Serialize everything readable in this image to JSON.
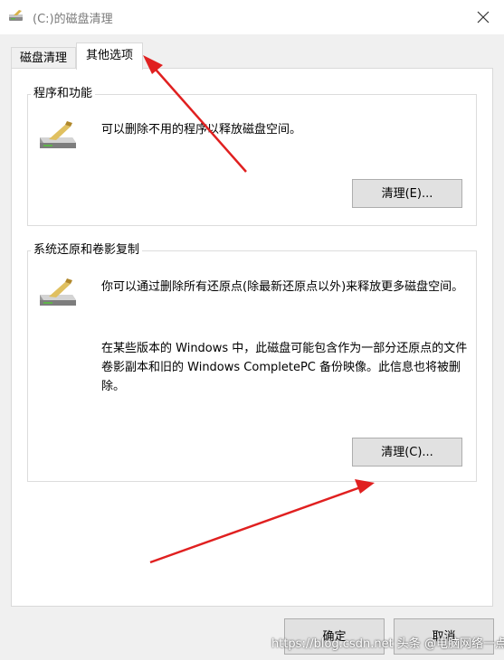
{
  "window": {
    "title": "(C:)的磁盘清理",
    "close_icon": "close-icon"
  },
  "tabs": [
    {
      "label": "磁盘清理",
      "active": false
    },
    {
      "label": "其他选项",
      "active": true
    }
  ],
  "groups": {
    "programs": {
      "title": "程序和功能",
      "icon": "disk-cleanup-icon",
      "description": "可以删除不用的程序以释放磁盘空间。",
      "button_label": "清理(E)..."
    },
    "restore": {
      "title": "系统还原和卷影复制",
      "icon": "disk-cleanup-icon",
      "description_1": "你可以通过删除所有还原点(除最新还原点以外)来释放更多磁盘空间。",
      "description_2": "在某些版本的 Windows 中，此磁盘可能包含作为一部分还原点的文件卷影副本和旧的 Windows CompletePC 备份映像。此信息也将被删除。",
      "button_label": "清理(C)..."
    }
  },
  "footer": {
    "ok_label": "确定",
    "cancel_label": "取消"
  },
  "watermark": {
    "text": "https://blog.csdn.net  头条 @电脑网络一点通"
  },
  "annotations": {
    "arrow_color": "#e02020"
  }
}
